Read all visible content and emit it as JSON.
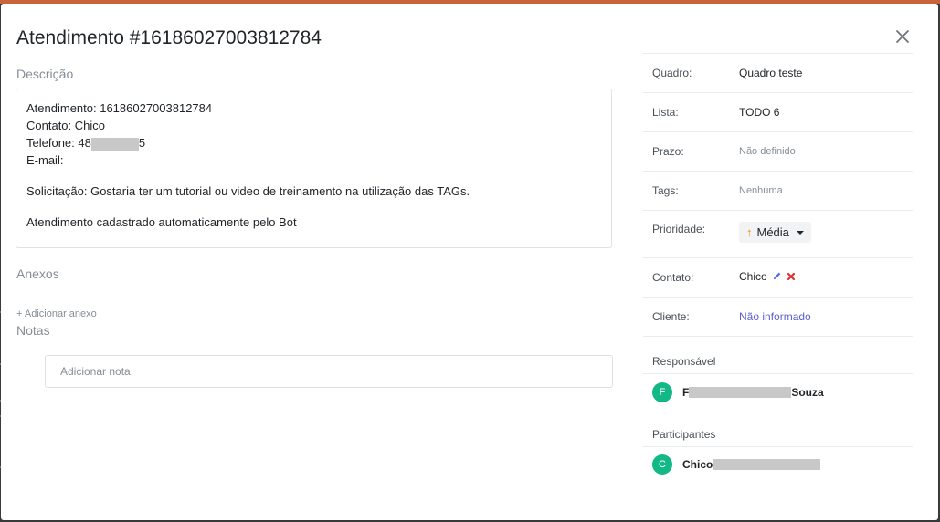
{
  "modal": {
    "title": "Atendimento #16186027003812784",
    "close_icon": "close-icon"
  },
  "description": {
    "label": "Descrição",
    "lines": {
      "atendimento": "Atendimento: 16186027003812784",
      "contato": "Contato: Chico",
      "telefone_prefix": "Telefone: 48",
      "telefone_suffix": "5",
      "email": "E-mail:",
      "solicitacao": "Solicitação: Gostaria ter um tutorial ou video de treinamento na utilização das TAGs.",
      "bot": "Atendimento cadastrado automaticamente pelo Bot"
    }
  },
  "attachments": {
    "label": "Anexos",
    "add_label": "+ Adicionar anexo"
  },
  "notes": {
    "label": "Notas",
    "placeholder": "Adicionar nota"
  },
  "details": {
    "quadro": {
      "key": "Quadro:",
      "value": "Quadro teste"
    },
    "lista": {
      "key": "Lista:",
      "value": "TODO 6"
    },
    "prazo": {
      "key": "Prazo:",
      "value": "Não definido"
    },
    "tags": {
      "key": "Tags:",
      "value": "Nenhuma"
    },
    "prioridade": {
      "key": "Prioridade:",
      "value": "Média",
      "icon": "arrow-up-icon",
      "color": "#f08c00"
    },
    "contato": {
      "key": "Contato:",
      "value": "Chico",
      "edit_icon": "pencil-icon",
      "remove_icon": "x-icon"
    },
    "cliente": {
      "key": "Cliente:",
      "value": "Não informado"
    }
  },
  "responsavel": {
    "label": "Responsável",
    "avatar": "F",
    "name_prefix": "F",
    "name_suffix": "Souza"
  },
  "participantes": {
    "label": "Participantes",
    "avatar": "C",
    "name": "Chico"
  },
  "colors": {
    "avatar": "#12b886",
    "link": "#5c5fcf",
    "remove": "#e03131",
    "edit": "#4c6ef5"
  }
}
